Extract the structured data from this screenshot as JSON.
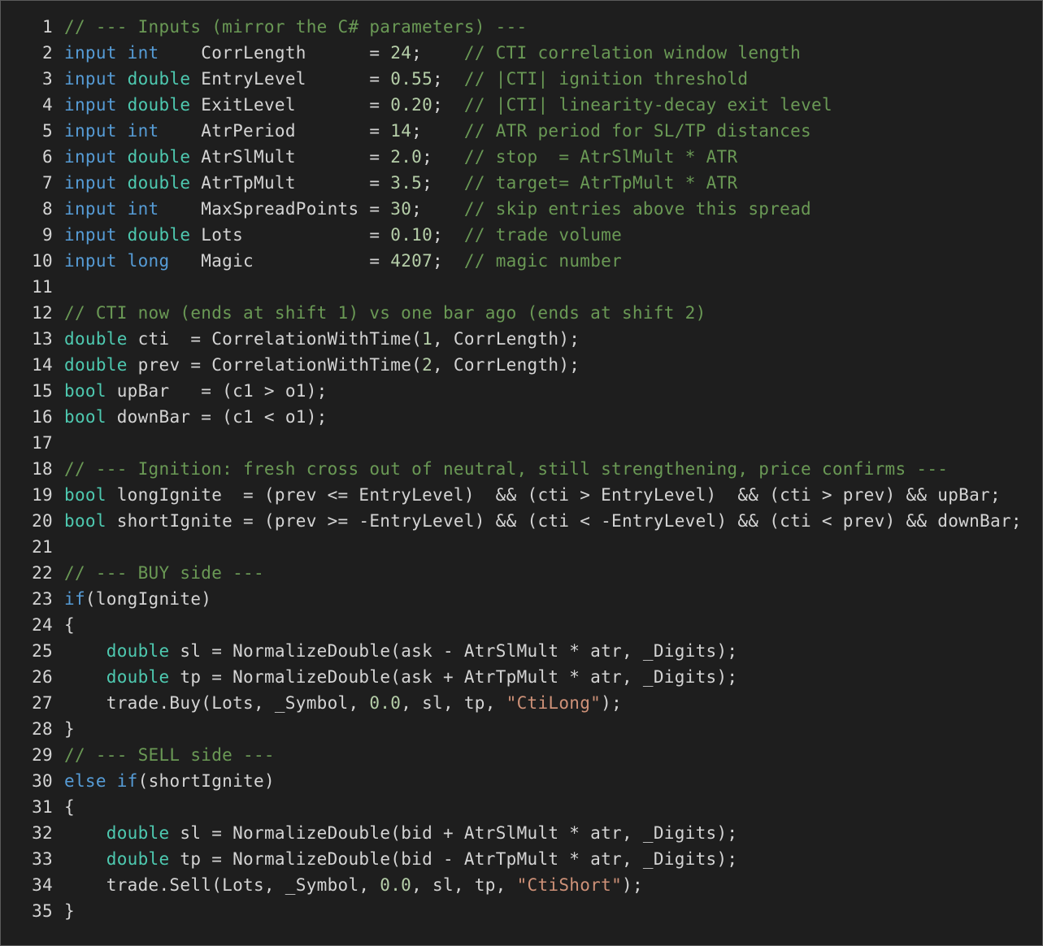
{
  "editor": {
    "theme": {
      "background": "#1e1e1e",
      "keyword": "#569cd6",
      "type": "#4ec9b0",
      "comment": "#6a9955",
      "number": "#b5cea8",
      "string": "#ce9178",
      "text": "#d4d4d4"
    },
    "lines": [
      {
        "n": "1",
        "tokens": [
          {
            "t": "cm",
            "v": "// --- Inputs (mirror the C# parameters) ---"
          }
        ]
      },
      {
        "n": "2",
        "tokens": [
          {
            "t": "kw",
            "v": "input"
          },
          {
            "t": "id",
            "v": " "
          },
          {
            "t": "kw",
            "v": "int"
          },
          {
            "t": "id",
            "v": "    CorrLength      = "
          },
          {
            "t": "nu",
            "v": "24"
          },
          {
            "t": "id",
            "v": ";    "
          },
          {
            "t": "cm",
            "v": "// CTI correlation window length"
          }
        ]
      },
      {
        "n": "3",
        "tokens": [
          {
            "t": "kw",
            "v": "input"
          },
          {
            "t": "id",
            "v": " "
          },
          {
            "t": "ty",
            "v": "double"
          },
          {
            "t": "id",
            "v": " EntryLevel      = "
          },
          {
            "t": "nu",
            "v": "0.55"
          },
          {
            "t": "id",
            "v": ";  "
          },
          {
            "t": "cm",
            "v": "// |CTI| ignition threshold"
          }
        ]
      },
      {
        "n": "4",
        "tokens": [
          {
            "t": "kw",
            "v": "input"
          },
          {
            "t": "id",
            "v": " "
          },
          {
            "t": "ty",
            "v": "double"
          },
          {
            "t": "id",
            "v": " ExitLevel       = "
          },
          {
            "t": "nu",
            "v": "0.20"
          },
          {
            "t": "id",
            "v": ";  "
          },
          {
            "t": "cm",
            "v": "// |CTI| linearity-decay exit level"
          }
        ]
      },
      {
        "n": "5",
        "tokens": [
          {
            "t": "kw",
            "v": "input"
          },
          {
            "t": "id",
            "v": " "
          },
          {
            "t": "kw",
            "v": "int"
          },
          {
            "t": "id",
            "v": "    AtrPeriod       = "
          },
          {
            "t": "nu",
            "v": "14"
          },
          {
            "t": "id",
            "v": ";    "
          },
          {
            "t": "cm",
            "v": "// ATR period for SL/TP distances"
          }
        ]
      },
      {
        "n": "6",
        "tokens": [
          {
            "t": "kw",
            "v": "input"
          },
          {
            "t": "id",
            "v": " "
          },
          {
            "t": "ty",
            "v": "double"
          },
          {
            "t": "id",
            "v": " AtrSlMult       = "
          },
          {
            "t": "nu",
            "v": "2.0"
          },
          {
            "t": "id",
            "v": ";   "
          },
          {
            "t": "cm",
            "v": "// stop  = AtrSlMult * ATR"
          }
        ]
      },
      {
        "n": "7",
        "tokens": [
          {
            "t": "kw",
            "v": "input"
          },
          {
            "t": "id",
            "v": " "
          },
          {
            "t": "ty",
            "v": "double"
          },
          {
            "t": "id",
            "v": " AtrTpMult       = "
          },
          {
            "t": "nu",
            "v": "3.5"
          },
          {
            "t": "id",
            "v": ";   "
          },
          {
            "t": "cm",
            "v": "// target= AtrTpMult * ATR"
          }
        ]
      },
      {
        "n": "8",
        "tokens": [
          {
            "t": "kw",
            "v": "input"
          },
          {
            "t": "id",
            "v": " "
          },
          {
            "t": "kw",
            "v": "int"
          },
          {
            "t": "id",
            "v": "    MaxSpreadPoints = "
          },
          {
            "t": "nu",
            "v": "30"
          },
          {
            "t": "id",
            "v": ";    "
          },
          {
            "t": "cm",
            "v": "// skip entries above this spread"
          }
        ]
      },
      {
        "n": "9",
        "tokens": [
          {
            "t": "kw",
            "v": "input"
          },
          {
            "t": "id",
            "v": " "
          },
          {
            "t": "ty",
            "v": "double"
          },
          {
            "t": "id",
            "v": " Lots            = "
          },
          {
            "t": "nu",
            "v": "0.10"
          },
          {
            "t": "id",
            "v": ";  "
          },
          {
            "t": "cm",
            "v": "// trade volume"
          }
        ]
      },
      {
        "n": "10",
        "tokens": [
          {
            "t": "kw",
            "v": "input"
          },
          {
            "t": "id",
            "v": " "
          },
          {
            "t": "kw",
            "v": "long"
          },
          {
            "t": "id",
            "v": "   Magic           = "
          },
          {
            "t": "nu",
            "v": "4207"
          },
          {
            "t": "id",
            "v": ";  "
          },
          {
            "t": "cm",
            "v": "// magic number"
          }
        ]
      },
      {
        "n": "11",
        "tokens": []
      },
      {
        "n": "12",
        "tokens": [
          {
            "t": "cm",
            "v": "// CTI now (ends at shift 1) vs one bar ago (ends at shift 2)"
          }
        ]
      },
      {
        "n": "13",
        "tokens": [
          {
            "t": "ty",
            "v": "double"
          },
          {
            "t": "id",
            "v": " cti  = CorrelationWithTime("
          },
          {
            "t": "nu",
            "v": "1"
          },
          {
            "t": "id",
            "v": ", CorrLength);"
          }
        ]
      },
      {
        "n": "14",
        "tokens": [
          {
            "t": "ty",
            "v": "double"
          },
          {
            "t": "id",
            "v": " prev = CorrelationWithTime("
          },
          {
            "t": "nu",
            "v": "2"
          },
          {
            "t": "id",
            "v": ", CorrLength);"
          }
        ]
      },
      {
        "n": "15",
        "tokens": [
          {
            "t": "ty",
            "v": "bool"
          },
          {
            "t": "id",
            "v": " upBar   = (c1 > o1);"
          }
        ]
      },
      {
        "n": "16",
        "tokens": [
          {
            "t": "ty",
            "v": "bool"
          },
          {
            "t": "id",
            "v": " downBar = (c1 < o1);"
          }
        ]
      },
      {
        "n": "17",
        "tokens": []
      },
      {
        "n": "18",
        "tokens": [
          {
            "t": "cm",
            "v": "// --- Ignition: fresh cross out of neutral, still strengthening, price confirms ---"
          }
        ]
      },
      {
        "n": "19",
        "tokens": [
          {
            "t": "ty",
            "v": "bool"
          },
          {
            "t": "id",
            "v": " longIgnite  = (prev <= EntryLevel)  && (cti > EntryLevel)  && (cti > prev) && upBar;"
          }
        ]
      },
      {
        "n": "20",
        "tokens": [
          {
            "t": "ty",
            "v": "bool"
          },
          {
            "t": "id",
            "v": " shortIgnite = (prev >= -EntryLevel) && (cti < -EntryLevel) && (cti < prev) && downBar;"
          }
        ]
      },
      {
        "n": "21",
        "tokens": []
      },
      {
        "n": "22",
        "tokens": [
          {
            "t": "cm",
            "v": "// --- BUY side ---"
          }
        ]
      },
      {
        "n": "23",
        "tokens": [
          {
            "t": "kw",
            "v": "if"
          },
          {
            "t": "id",
            "v": "(longIgnite)"
          }
        ]
      },
      {
        "n": "24",
        "tokens": [
          {
            "t": "id",
            "v": "{"
          }
        ]
      },
      {
        "n": "25",
        "tokens": [
          {
            "t": "id",
            "v": "    "
          },
          {
            "t": "ty",
            "v": "double"
          },
          {
            "t": "id",
            "v": " sl = NormalizeDouble(ask - AtrSlMult * atr, _Digits);"
          }
        ]
      },
      {
        "n": "26",
        "tokens": [
          {
            "t": "id",
            "v": "    "
          },
          {
            "t": "ty",
            "v": "double"
          },
          {
            "t": "id",
            "v": " tp = NormalizeDouble(ask + AtrTpMult * atr, _Digits);"
          }
        ]
      },
      {
        "n": "27",
        "tokens": [
          {
            "t": "id",
            "v": "    trade.Buy(Lots, _Symbol, "
          },
          {
            "t": "nu",
            "v": "0.0"
          },
          {
            "t": "id",
            "v": ", sl, tp, "
          },
          {
            "t": "st",
            "v": "\"CtiLong\""
          },
          {
            "t": "id",
            "v": ");"
          }
        ]
      },
      {
        "n": "28",
        "tokens": [
          {
            "t": "id",
            "v": "}"
          }
        ]
      },
      {
        "n": "29",
        "tokens": [
          {
            "t": "cm",
            "v": "// --- SELL side ---"
          }
        ]
      },
      {
        "n": "30",
        "tokens": [
          {
            "t": "kw",
            "v": "else"
          },
          {
            "t": "id",
            "v": " "
          },
          {
            "t": "kw",
            "v": "if"
          },
          {
            "t": "id",
            "v": "(shortIgnite)"
          }
        ]
      },
      {
        "n": "31",
        "tokens": [
          {
            "t": "id",
            "v": "{"
          }
        ]
      },
      {
        "n": "32",
        "tokens": [
          {
            "t": "id",
            "v": "    "
          },
          {
            "t": "ty",
            "v": "double"
          },
          {
            "t": "id",
            "v": " sl = NormalizeDouble(bid + AtrSlMult * atr, _Digits);"
          }
        ]
      },
      {
        "n": "33",
        "tokens": [
          {
            "t": "id",
            "v": "    "
          },
          {
            "t": "ty",
            "v": "double"
          },
          {
            "t": "id",
            "v": " tp = NormalizeDouble(bid - AtrTpMult * atr, _Digits);"
          }
        ]
      },
      {
        "n": "34",
        "tokens": [
          {
            "t": "id",
            "v": "    trade.Sell(Lots, _Symbol, "
          },
          {
            "t": "nu",
            "v": "0.0"
          },
          {
            "t": "id",
            "v": ", sl, tp, "
          },
          {
            "t": "st",
            "v": "\"CtiShort\""
          },
          {
            "t": "id",
            "v": ");"
          }
        ]
      },
      {
        "n": "35",
        "tokens": [
          {
            "t": "id",
            "v": "}"
          }
        ]
      }
    ]
  }
}
